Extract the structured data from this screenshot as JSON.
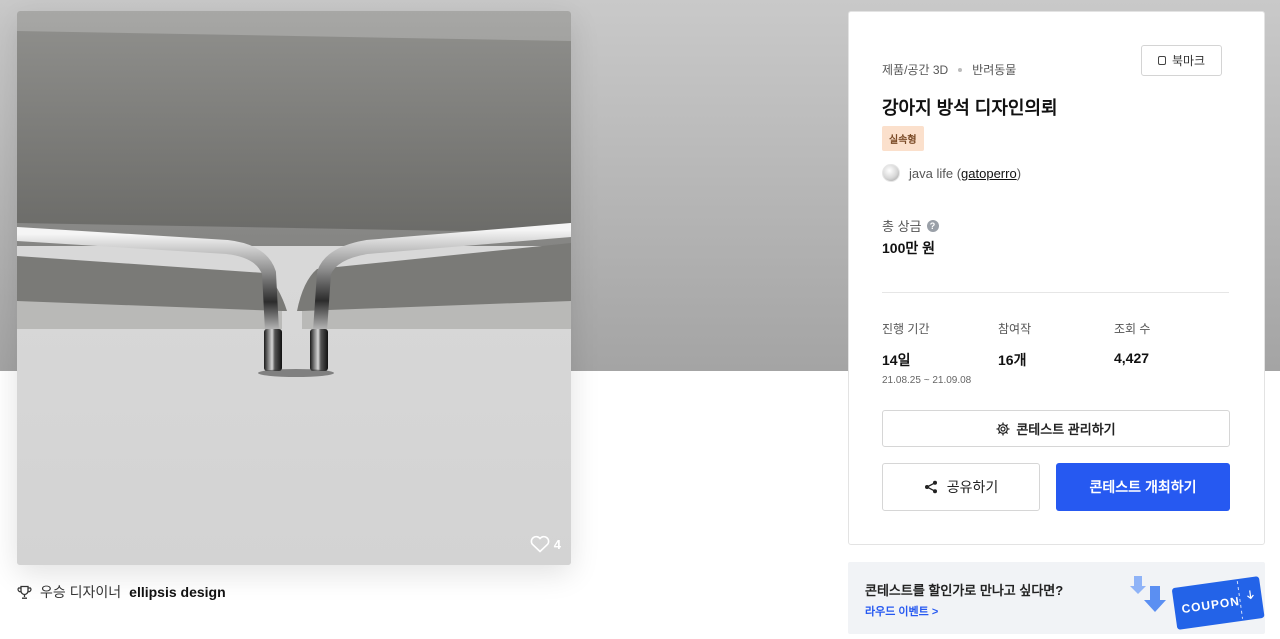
{
  "artwork": {
    "like_count": "4",
    "winner_prefix": "우승 디자이너",
    "winner_name": "ellipsis design"
  },
  "contest": {
    "category": "제품/공간 3D",
    "subcategory": "반려동물",
    "bookmark_label": "북마크",
    "title": "강아지 방석 디자인의뢰",
    "badge": "실속형",
    "host_name": "java life (",
    "host_handle": "gatoperro",
    "host_close": ")",
    "prize_label": "총 상금",
    "prize_help": "?",
    "prize_value": "100만 원",
    "stats": {
      "period_label": "진행 기간",
      "period_value": "14일",
      "period_range": "21.08.25 ~ 21.09.08",
      "entries_label": "참여작",
      "entries_value": "16개",
      "views_label": "조회 수",
      "views_value": "4,427"
    },
    "manage_button": "콘테스트 관리하기",
    "share_button": "공유하기",
    "host_button": "콘테스트 개최하기"
  },
  "banner": {
    "title": "콘테스트를 할인가로 만나고 싶다면?",
    "link": "라우드 이벤트 >",
    "coupon_text": "COUPON"
  },
  "colors": {
    "primary": "#2659f1",
    "badge_bg": "#fbe0cc",
    "coupon": "#2363e8"
  }
}
